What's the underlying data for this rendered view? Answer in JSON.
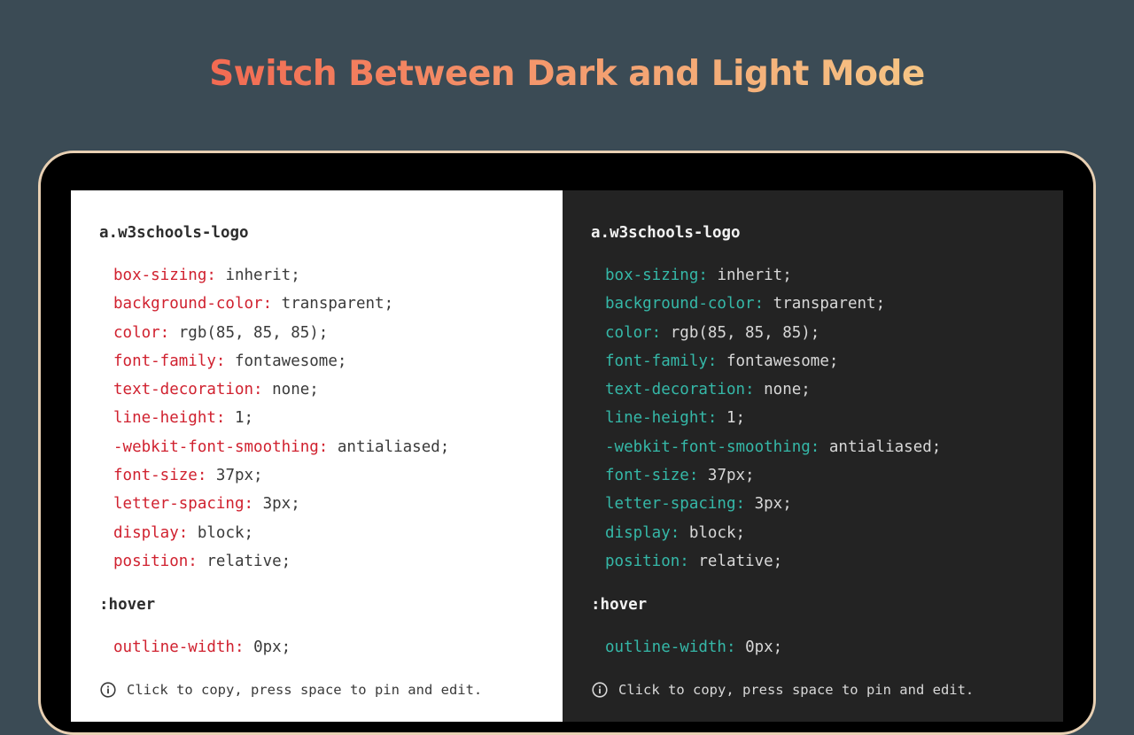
{
  "headline": "Switch Between Dark and Light Mode",
  "colors": {
    "background": "#3b4b55",
    "headline_gradient_start": "#f26a52",
    "headline_gradient_end": "#f6c585",
    "laptop_bezel": "#000000",
    "laptop_rim": "#e8d0b3",
    "light_panel_bg": "#ffffff",
    "light_property": "#d0212f",
    "dark_panel_bg": "#232323",
    "dark_property": "#35b8a8"
  },
  "inspector": {
    "selector": "a.w3schools-logo",
    "declarations": [
      {
        "property": "box-sizing:",
        "value": "inherit;"
      },
      {
        "property": "background-color:",
        "value": "transparent;"
      },
      {
        "property": "color:",
        "value": "rgb(85, 85, 85);"
      },
      {
        "property": "font-family:",
        "value": "fontawesome;"
      },
      {
        "property": "text-decoration:",
        "value": "none;"
      },
      {
        "property": "line-height:",
        "value": "1;"
      },
      {
        "property": "-webkit-font-smoothing:",
        "value": "antialiased;"
      },
      {
        "property": "font-size:",
        "value": "37px;"
      },
      {
        "property": "letter-spacing:",
        "value": "3px;"
      },
      {
        "property": "display:",
        "value": "block;"
      },
      {
        "property": "position:",
        "value": "relative;"
      }
    ],
    "hover_selector": ":hover",
    "hover_declarations": [
      {
        "property": "outline-width:",
        "value": "0px;"
      }
    ],
    "footer_icon": "info-circle-icon",
    "footer_text": "Click to copy, press space to pin and edit."
  }
}
